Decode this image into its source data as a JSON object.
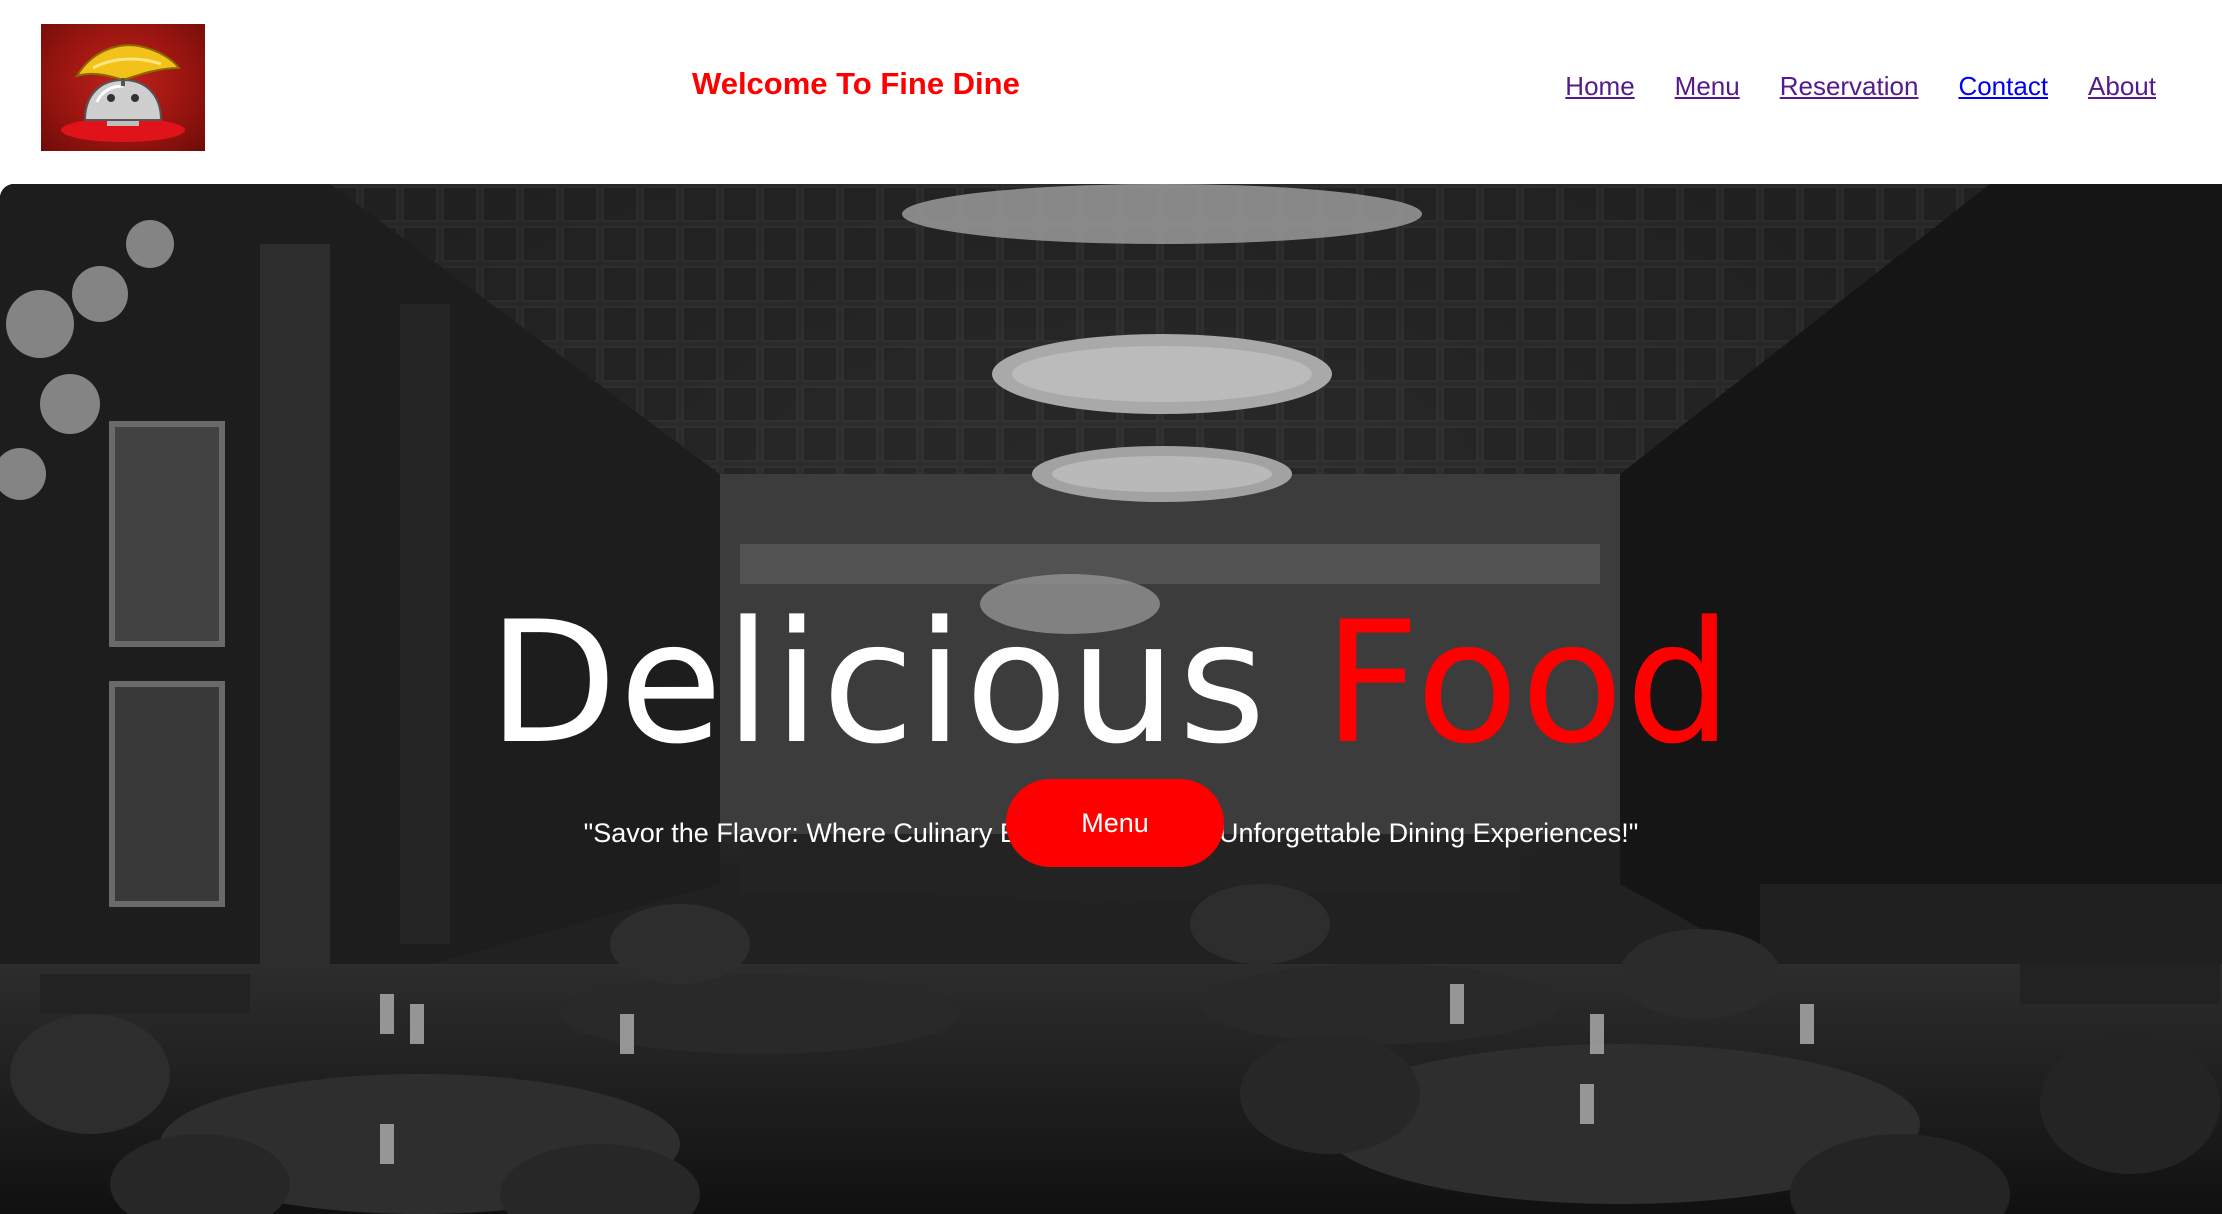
{
  "header": {
    "site_title": "Welcome To Fine Dine",
    "logo_icon": "chef-hat-cloche-icon",
    "nav": [
      {
        "label": "Home"
      },
      {
        "label": "Menu"
      },
      {
        "label": "Reservation"
      },
      {
        "label": "Contact"
      },
      {
        "label": "About"
      }
    ]
  },
  "hero": {
    "headline_part1": "Delicious",
    "headline_part2": "Food",
    "tagline": "\"Savor the Flavor: Where Culinary Excellence Meets Unforgettable Dining Experiences!\"",
    "cta_label": "Menu",
    "background": "restaurant-interior-photo"
  },
  "colors": {
    "accent": "#ff0000",
    "nav_visited": "#551a8b",
    "nav_link": "#0000ee",
    "headline_white": "#ffffff"
  }
}
